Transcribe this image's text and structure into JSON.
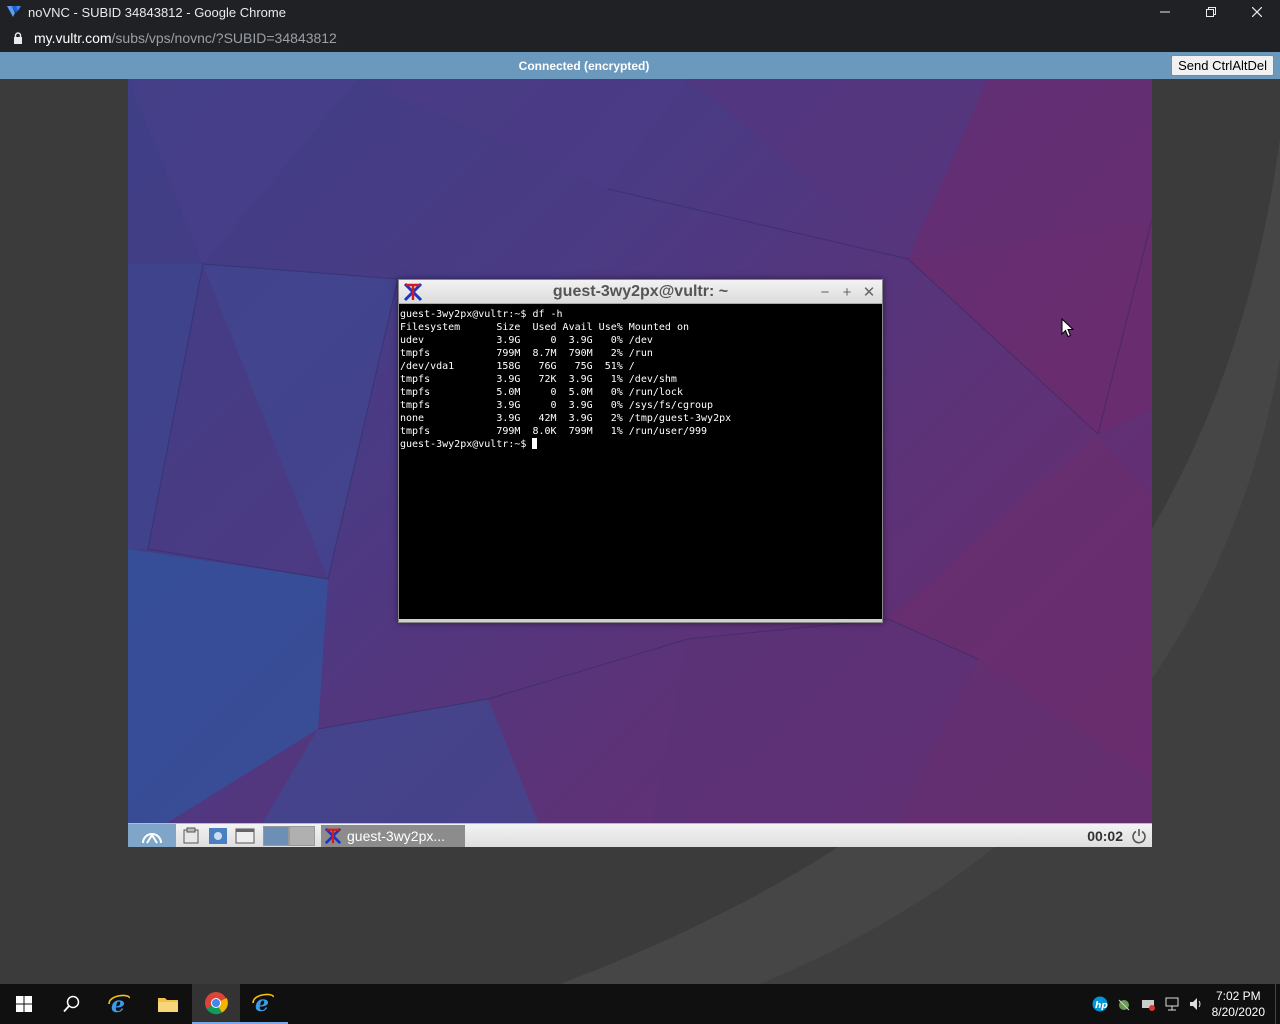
{
  "browser": {
    "window_title": "noVNC - SUBID 34843812 - Google Chrome",
    "url_host": "my.vultr.com",
    "url_path": "/subs/vps/novnc/?SUBID=34843812"
  },
  "novnc": {
    "status": "Connected (encrypted)",
    "send_cad_label": "Send CtrlAltDel"
  },
  "xterm": {
    "title": "guest-3wy2px@vultr: ~",
    "lines": [
      "guest-3wy2px@vultr:~$ df -h",
      "Filesystem      Size  Used Avail Use% Mounted on",
      "udev            3.9G     0  3.9G   0% /dev",
      "tmpfs           799M  8.7M  790M   2% /run",
      "/dev/vda1       158G   76G   75G  51% /",
      "tmpfs           3.9G   72K  3.9G   1% /dev/shm",
      "tmpfs           5.0M     0  5.0M   0% /run/lock",
      "tmpfs           3.9G     0  3.9G   0% /sys/fs/cgroup",
      "none            3.9G   42M  3.9G   2% /tmp/guest-3wy2px",
      "tmpfs           799M  8.0K  799M   1% /run/user/999"
    ],
    "prompt": "guest-3wy2px@vultr:~$ "
  },
  "remote_taskbar": {
    "task_label": "guest-3wy2px...",
    "clock": "00:02"
  },
  "windows_taskbar": {
    "time": "7:02 PM",
    "date": "8/20/2020"
  },
  "icons": {
    "window_min": "minimize-icon",
    "window_restore": "restore-icon",
    "window_close": "close-icon",
    "lock": "lock-icon"
  },
  "colors": {
    "novnc_bar": "#6b98bd",
    "chrome_dark": "#202124",
    "terminal_bg": "#000000"
  }
}
